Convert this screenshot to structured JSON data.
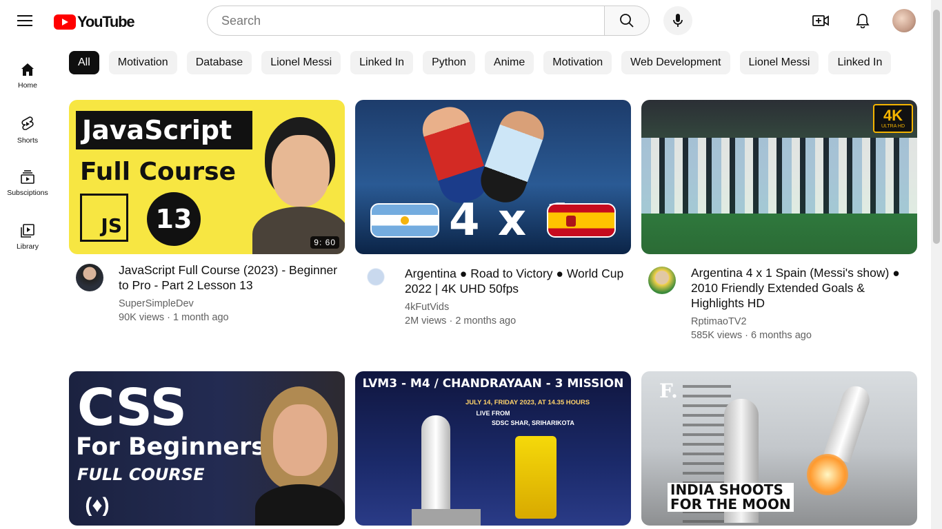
{
  "header": {
    "logo_text": "YouTube",
    "search_placeholder": "Search"
  },
  "sidebar": {
    "items": [
      {
        "label": "Home",
        "icon": "home-icon"
      },
      {
        "label": "Shorts",
        "icon": "shorts-icon"
      },
      {
        "label": "Subsciptions",
        "icon": "subscriptions-icon"
      },
      {
        "label": "Library",
        "icon": "library-icon"
      }
    ]
  },
  "chips": [
    "All",
    "Motivation",
    "Database",
    "Lionel Messi",
    "Linked In",
    "Python",
    "Anime",
    "Motivation",
    "Web Development",
    "Lionel Messi",
    "Linked In"
  ],
  "videos": [
    {
      "title": "JavaScript Full Course (2023) - Beginner to Pro - Part 2 Lesson 13",
      "channel": "SuperSimpleDev",
      "stats": "90K views · 1 month ago",
      "duration": "9: 60",
      "thumb_text": {
        "line1": "JavaScript",
        "line2": "Full Course",
        "badge": "JS",
        "number": "13"
      }
    },
    {
      "title": "Argentina ● Road to Victory ● World Cup 2022 | 4K UHD 50fps",
      "channel": "4kFutVids",
      "stats": "2M views · 2 months ago",
      "duration": "",
      "thumb_text": {
        "score": "4 x 1"
      }
    },
    {
      "title": "Argentina 4 x 1 Spain (Messi's show) ● 2010 Friendly Extended Goals & Highlights HD",
      "channel": "RptimaoTV2",
      "stats": "585K views · 6 months ago",
      "duration": "",
      "thumb_text": {
        "badge_big": "4K",
        "badge_small": "ULTRA HD"
      }
    },
    {
      "title": "",
      "channel": "",
      "stats": "",
      "duration": "",
      "thumb_text": {
        "line1": "CSS",
        "line2": "For Beginners",
        "line3": "FULL COURSE"
      }
    },
    {
      "title": "",
      "channel": "",
      "stats": "",
      "duration": "",
      "thumb_text": {
        "line1": "LVM3 - M4 / CHANDRAYAAN - 3 MISSION",
        "line2": "JULY 14, FRIDAY 2023, AT 14.35 HOURS",
        "line3": "LIVE FROM",
        "line4": "SDSC SHAR, SRIHARIKOTA"
      }
    },
    {
      "title": "",
      "channel": "",
      "stats": "",
      "duration": "",
      "thumb_text": {
        "brand": "F.",
        "line1": "INDIA SHOOTS",
        "line2": "FOR THE MOON"
      }
    }
  ],
  "colors": {
    "brand_red": "#ff0000",
    "chip_active": "#0f0f0f",
    "chip_bg": "#f2f2f2"
  }
}
